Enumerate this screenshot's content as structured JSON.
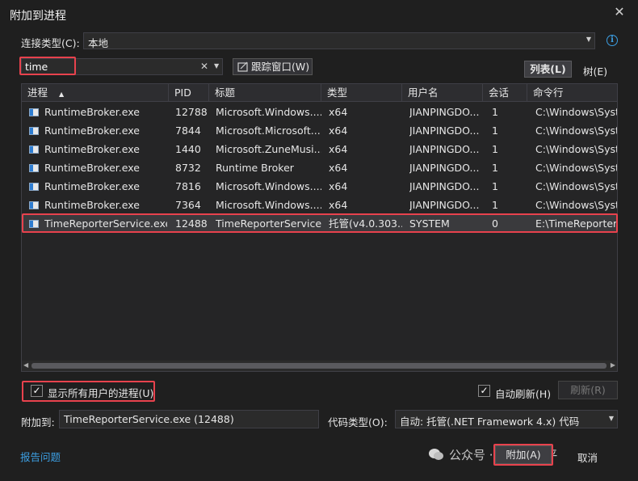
{
  "window": {
    "title": "附加到进程",
    "close_glyph": "✕"
  },
  "connection": {
    "label": "连接类型(C):",
    "value": "本地"
  },
  "filter": {
    "value": "time",
    "clear_glyph": "✕"
  },
  "track_window_label": "跟踪窗口(W)",
  "view_tabs": {
    "list": "列表(L)",
    "tree": "树(E)"
  },
  "table": {
    "headers": [
      "进程",
      "PID",
      "标题",
      "类型",
      "用户名",
      "会话",
      "命令行"
    ],
    "sort_glyph": "▲",
    "rows": [
      [
        "RuntimeBroker.exe",
        "12788",
        "Microsoft.Windows....",
        "x64",
        "JIANPINGDO...",
        "1",
        "C:\\Windows\\Syste"
      ],
      [
        "RuntimeBroker.exe",
        "7844",
        "Microsoft.Microsoft...",
        "x64",
        "JIANPINGDO...",
        "1",
        "C:\\Windows\\Syste"
      ],
      [
        "RuntimeBroker.exe",
        "1440",
        "Microsoft.ZuneMusi...",
        "x64",
        "JIANPINGDO...",
        "1",
        "C:\\Windows\\Syste"
      ],
      [
        "RuntimeBroker.exe",
        "8732",
        "Runtime Broker",
        "x64",
        "JIANPINGDO...",
        "1",
        "C:\\Windows\\Syste"
      ],
      [
        "RuntimeBroker.exe",
        "7816",
        "Microsoft.Windows....",
        "x64",
        "JIANPINGDO...",
        "1",
        "C:\\Windows\\Syste"
      ],
      [
        "RuntimeBroker.exe",
        "7364",
        "Microsoft.Windows....",
        "x64",
        "JIANPINGDO...",
        "1",
        "C:\\Windows\\Syste"
      ],
      [
        "TimeReporterService.exe",
        "12488",
        "TimeReporterService",
        "托管(v4.0.303...",
        "SYSTEM",
        "0",
        "E:\\TimeReporterS"
      ]
    ],
    "selected_row": 6
  },
  "show_all_users": {
    "label": "显示所有用户的进程(U)",
    "checked": true
  },
  "auto_refresh": {
    "label": "自动刷新(H)",
    "checked": true
  },
  "refresh_label": "刷新(R)",
  "attach_to": {
    "label": "附加到:",
    "value": "TimeReporterService.exe (12488)"
  },
  "code_type": {
    "label": "代码类型(O):",
    "value": "自动: 托管(.NET Framework 4.x) 代码"
  },
  "report_issue": "报告问题",
  "attach_button": "附加(A)",
  "cancel_button": "取消",
  "watermark": "公众号 · 大城师勾平",
  "colors": {
    "highlight": "#e8424d",
    "accent": "#3c9fe3"
  }
}
